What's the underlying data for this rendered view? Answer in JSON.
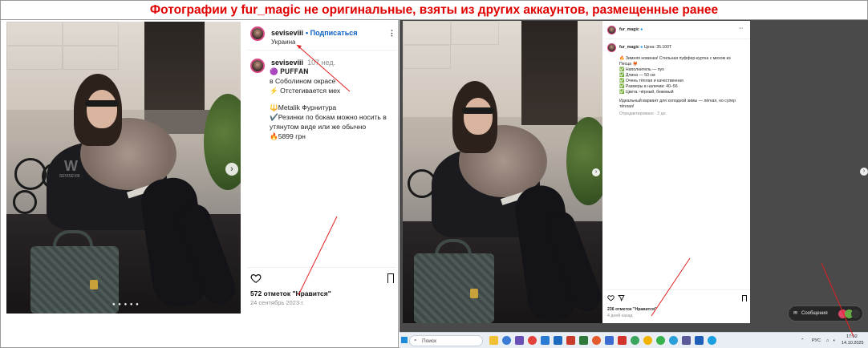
{
  "headline": "Фотографии у fur_magic не оригинальные, взяты из других аккаунтов, размещенные ранее",
  "left_post": {
    "username": "seviseviii",
    "follow_label": "Подписаться",
    "location": "Украина",
    "caption_username": "seviseviii",
    "caption_time": "107 нед.",
    "caption_lines": [
      "🟣 𝐏𝐔𝐅𝐅𝐀𝐍",
      "в Соболином окрасе",
      "⚡ Отстегивается мех",
      "",
      "🔱Metalik Фурнитура",
      "✔️Резинки по бокам можно носить в",
      "утянутом виде или же обычно",
      "🔥5899 грн"
    ],
    "likes": "572 отметок \"Нравится\"",
    "date": "24 сентябрь 2023 г.",
    "watermark": "SEVISEVIII"
  },
  "right_post": {
    "username": "fur_magic",
    "caption_username": "fur_magic",
    "price_line": "Цена: 35.100Т",
    "caption_lines": [
      "🔥 Зимняя новинка! Стильная пуффер-куртка с мехом из",
      "Песца 🦊",
      "✅ Наполнитель — пух",
      "✅ Длина — 50 см",
      "✅ Очень тёплая и качественная",
      "✅ Размеры в наличии: 40–56",
      "✅ Цвета: чёрный, бежевый",
      "",
      "Идеальный вариант для холодной зимы — лёгкая, но супер",
      "тёплая!"
    ],
    "edited": "Отредактировано · 2 дн.",
    "likes": "236 отметок \"Нравится\"",
    "date": "4 дней назад"
  },
  "messages_label": "Сообщения",
  "taskbar": {
    "search_placeholder": "Поиск",
    "lang": "РУС",
    "time": "17:02",
    "date": "14.10.2025"
  }
}
